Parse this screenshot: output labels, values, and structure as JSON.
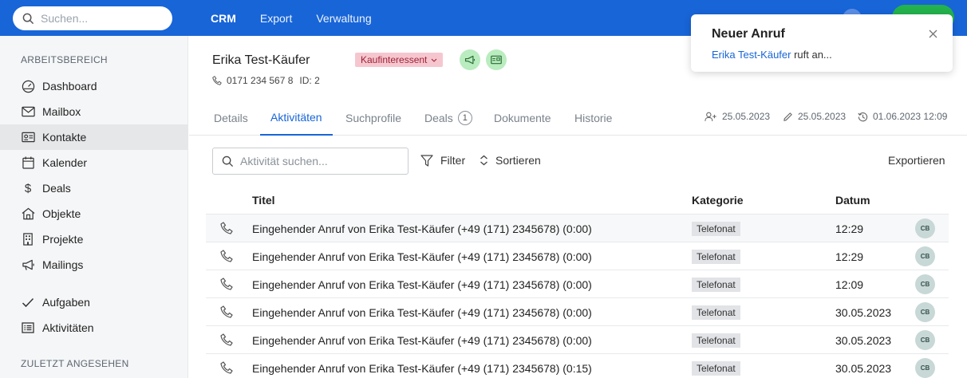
{
  "search": {
    "placeholder": "Suchen..."
  },
  "nav": [
    {
      "label": "CRM"
    },
    {
      "label": "Export"
    },
    {
      "label": "Verwaltung"
    }
  ],
  "sidebar": {
    "workspace_title": "ARBEITSBEREICH",
    "items": [
      {
        "label": "Dashboard",
        "icon": "dashboard-icon"
      },
      {
        "label": "Mailbox",
        "icon": "mail-icon"
      },
      {
        "label": "Kontakte",
        "icon": "contact-card-icon"
      },
      {
        "label": "Kalender",
        "icon": "calendar-icon"
      },
      {
        "label": "Deals",
        "icon": "dollar-icon"
      },
      {
        "label": "Objekte",
        "icon": "house-icon"
      },
      {
        "label": "Projekte",
        "icon": "building-icon"
      },
      {
        "label": "Mailings",
        "icon": "megaphone-icon"
      }
    ],
    "items2": [
      {
        "label": "Aufgaben",
        "icon": "check-icon"
      },
      {
        "label": "Aktivitäten",
        "icon": "list-icon"
      }
    ],
    "recent_title": "ZULETZT ANGESEHEN"
  },
  "contact": {
    "name": "Erika Test-Käufer",
    "badge": "Kaufinteressent",
    "phone": "0171 234 567 8",
    "id_label": "ID: 2"
  },
  "tabs": [
    {
      "label": "Details"
    },
    {
      "label": "Aktivitäten"
    },
    {
      "label": "Suchprofile"
    },
    {
      "label": "Deals",
      "count": "1"
    },
    {
      "label": "Dokumente"
    },
    {
      "label": "Historie"
    }
  ],
  "meta": {
    "created": "25.05.2023",
    "edited": "25.05.2023",
    "history": "01.06.2023 12:09"
  },
  "toolbar": {
    "search_placeholder": "Aktivität suchen...",
    "filter": "Filter",
    "sort": "Sortieren",
    "export": "Exportieren"
  },
  "table": {
    "columns": [
      "Titel",
      "Kategorie",
      "Datum"
    ],
    "rows": [
      {
        "title": "Eingehender Anruf von Erika Test-Käufer (+49 (171) 2345678) (0:00)",
        "category": "Telefonat",
        "date": "12:29",
        "user": "CB"
      },
      {
        "title": "Eingehender Anruf von Erika Test-Käufer (+49 (171) 2345678) (0:00)",
        "category": "Telefonat",
        "date": "12:29",
        "user": "CB"
      },
      {
        "title": "Eingehender Anruf von Erika Test-Käufer (+49 (171) 2345678) (0:00)",
        "category": "Telefonat",
        "date": "12:09",
        "user": "CB"
      },
      {
        "title": "Eingehender Anruf von Erika Test-Käufer (+49 (171) 2345678) (0:00)",
        "category": "Telefonat",
        "date": "30.05.2023",
        "user": "CB"
      },
      {
        "title": "Eingehender Anruf von Erika Test-Käufer (+49 (171) 2345678) (0:00)",
        "category": "Telefonat",
        "date": "30.05.2023",
        "user": "CB"
      },
      {
        "title": "Eingehender Anruf von Erika Test-Käufer (+49 (171) 2345678) (0:15)",
        "category": "Telefonat",
        "date": "30.05.2023",
        "user": "CB"
      }
    ]
  },
  "notification": {
    "title": "Neuer Anruf",
    "caller": "Erika Test-Käufer",
    "text": " ruft an..."
  },
  "colors": {
    "primary": "#1865d8",
    "badge_bg": "#f6c6cf",
    "action_green": "#b9ecbf"
  }
}
